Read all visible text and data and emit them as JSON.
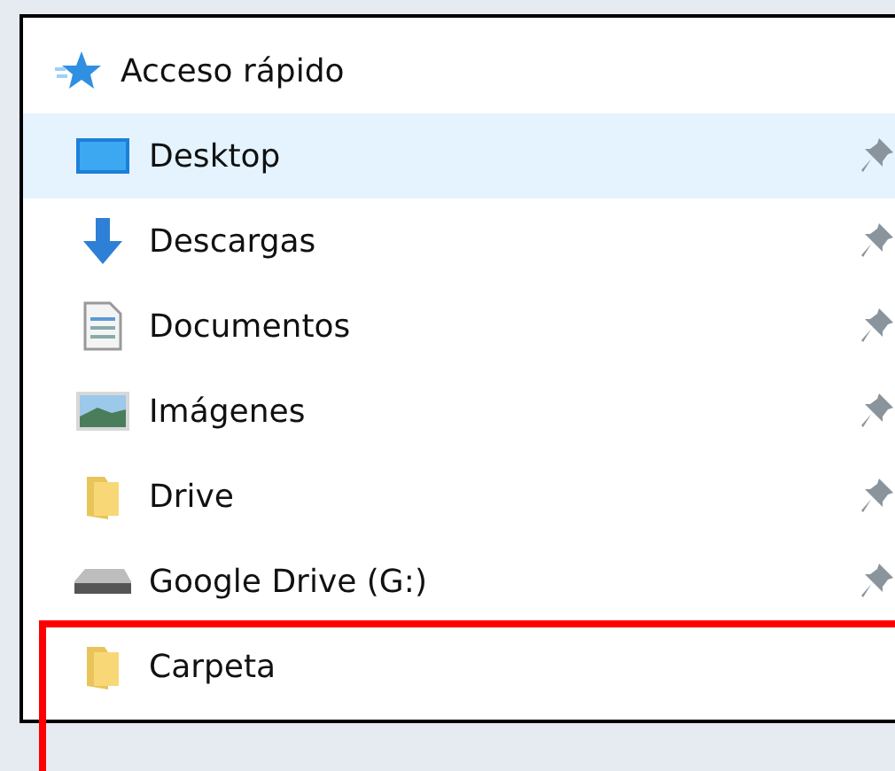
{
  "quick_access": {
    "label": "Acceso rápido"
  },
  "items": [
    {
      "label": "Desktop",
      "kind": "desktop",
      "pinned": true,
      "selected": true
    },
    {
      "label": "Descargas",
      "kind": "download",
      "pinned": true,
      "selected": false
    },
    {
      "label": "Documentos",
      "kind": "document",
      "pinned": true,
      "selected": false
    },
    {
      "label": "Imágenes",
      "kind": "pictures",
      "pinned": true,
      "selected": false
    },
    {
      "label": "Drive",
      "kind": "folder",
      "pinned": true,
      "selected": false
    },
    {
      "label": "Google Drive (G:)",
      "kind": "drive",
      "pinned": true,
      "selected": false
    },
    {
      "label": "Carpeta",
      "kind": "folder",
      "pinned": false,
      "selected": false
    }
  ]
}
